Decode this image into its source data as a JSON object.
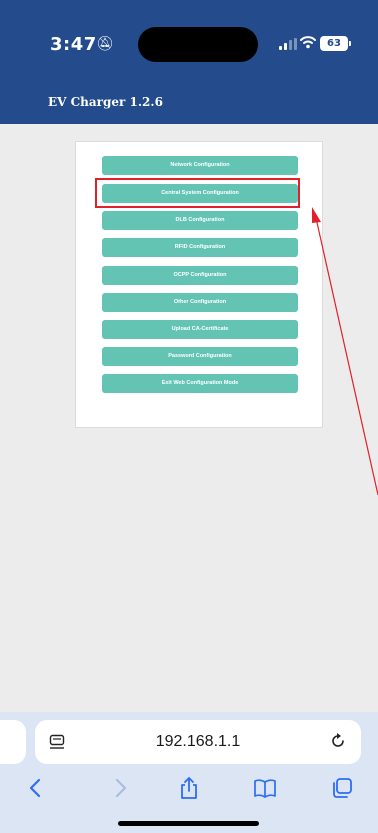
{
  "status_bar": {
    "time": "3:47",
    "battery": "63"
  },
  "app": {
    "title": "EV Charger 1.2.6"
  },
  "menu": {
    "items": [
      "Network Configuration",
      "Central System Configuration",
      "DLB Configuration",
      "RFID Configuration",
      "OCPP Configuration",
      "Other Configuration",
      "Upload CA-Certificate",
      "Password Configuration",
      "Exit Web Configuration Mode"
    ],
    "highlighted_item": "Central System Configuration"
  },
  "browser": {
    "url": "192.168.1.1",
    "toolbar_icons": [
      "back-icon",
      "forward-icon",
      "share-icon",
      "bookmarks-icon",
      "tabs-icon"
    ]
  },
  "colors": {
    "header": "#244c8c",
    "button": "#63c4b4",
    "highlight": "#e0202a",
    "toolbar_icon": "#2d6ef5",
    "toolbar_icon_disabled": "#a9bde3"
  }
}
